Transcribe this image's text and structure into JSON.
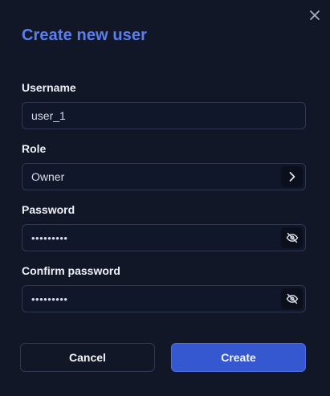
{
  "dialog": {
    "title": "Create new user",
    "close_icon": "close-icon"
  },
  "fields": {
    "username": {
      "label": "Username",
      "value": "user_1"
    },
    "role": {
      "label": "Role",
      "value": "Owner",
      "icon": "chevron-right-icon"
    },
    "password": {
      "label": "Password",
      "value": "•••••••••",
      "icon": "eye-off-icon"
    },
    "confirm_password": {
      "label": "Confirm password",
      "value": "•••••••••",
      "icon": "eye-off-icon"
    }
  },
  "actions": {
    "cancel_label": "Cancel",
    "create_label": "Create"
  },
  "colors": {
    "background": "#121728",
    "title": "#5b7ff0",
    "primary_button": "#3557cf",
    "border": "#2f3850"
  }
}
